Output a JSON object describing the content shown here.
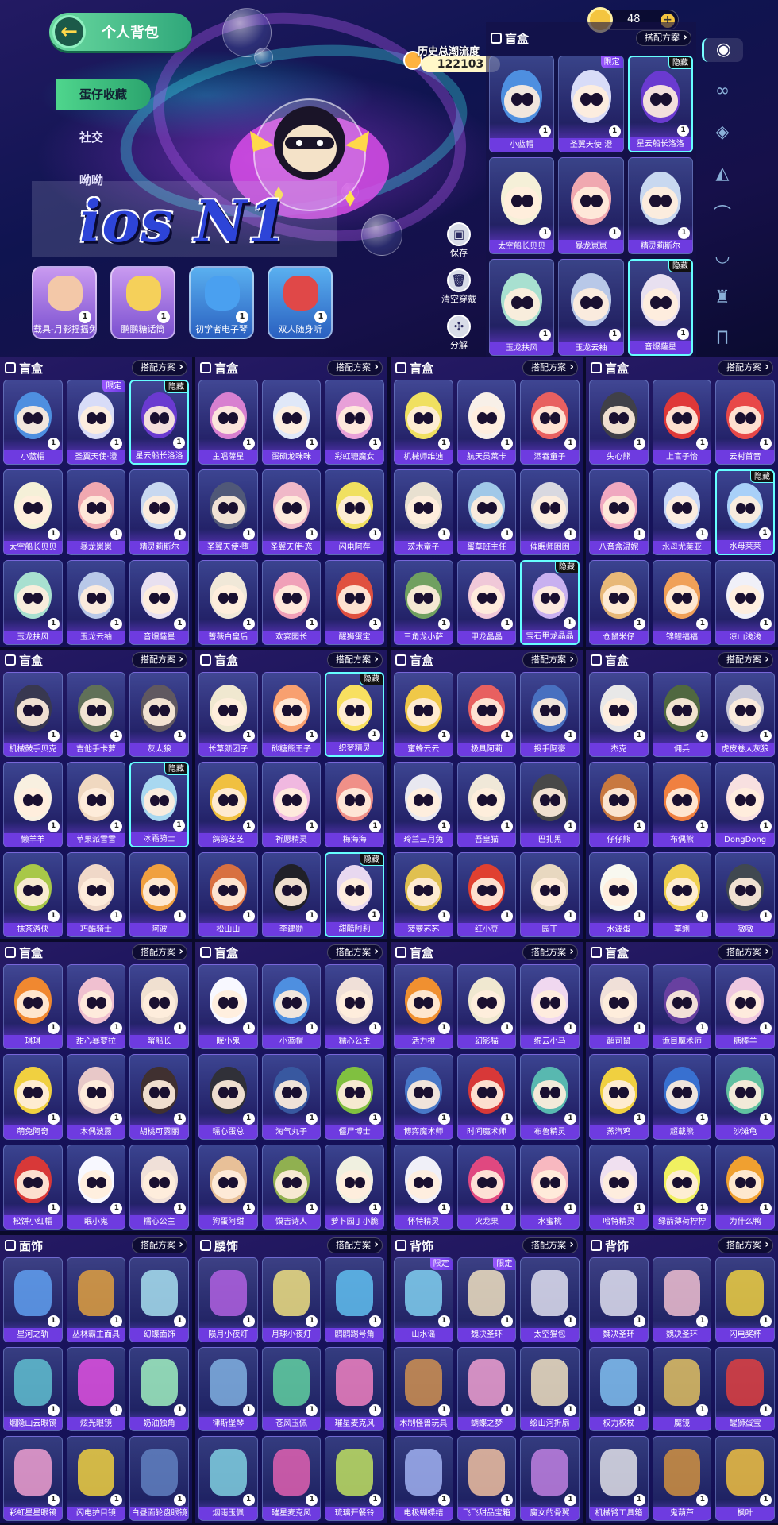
{
  "hero": {
    "back_title": "个人背包",
    "categories": [
      "蛋仔收藏",
      "社交",
      "呦呦"
    ],
    "watermark": "ios N1",
    "quick_items": [
      {
        "label": "载具-月影摇摇兔",
        "count": "1",
        "color": "#f3c8a8"
      },
      {
        "label": "鹏鹏糖话筒",
        "count": "1",
        "color": "#f5d05a"
      },
      {
        "label": "初学者电子琴",
        "count": "1",
        "color": "#4aa0f0"
      },
      {
        "label": "双人随身听",
        "count": "1",
        "color": "#e04848"
      }
    ],
    "side_actions": [
      {
        "label": "保存",
        "icon": "save-icon",
        "glyph": "▣"
      },
      {
        "label": "清空穿戴",
        "icon": "trash-icon",
        "glyph": "🗑"
      },
      {
        "label": "分解",
        "icon": "decompose-icon",
        "glyph": "✣"
      }
    ],
    "heat_label": "历史总潮流度",
    "heat_value": "122103",
    "coins": "48",
    "coin_plus": "+",
    "rail_icons": [
      {
        "name": "egg-figure-icon",
        "glyph": "◉"
      },
      {
        "name": "glasses-icon",
        "glyph": "∞"
      },
      {
        "name": "face-icon",
        "glyph": "◈"
      },
      {
        "name": "bag-icon",
        "glyph": "◭"
      },
      {
        "name": "eyelash-icon",
        "glyph": "⌒"
      },
      {
        "name": "eyes-icon",
        "glyph": "◡"
      },
      {
        "name": "shirt-icon",
        "glyph": "♜"
      },
      {
        "name": "pants-icon",
        "glyph": "Π"
      }
    ]
  },
  "hero_panel": {
    "title": "盲盒",
    "button": "搭配方案",
    "items": [
      {
        "name": "小蓝帽",
        "count": "1",
        "color": "#4e8fe0"
      },
      {
        "name": "圣翼天使·澄",
        "count": "1",
        "color": "#d8dcf8",
        "tag": "限定"
      },
      {
        "name": "星云船长洛洛",
        "count": "1",
        "color": "#6a3ad0",
        "tag": "隐藏"
      },
      {
        "name": "太空船长贝贝",
        "count": "1",
        "color": "#f5f0d8"
      },
      {
        "name": "暴龙崽崽",
        "count": "1",
        "color": "#f0a8b0"
      },
      {
        "name": "精灵莉斯尔",
        "count": "1",
        "color": "#c8d8f0"
      },
      {
        "name": "玉龙扶风",
        "count": "1",
        "color": "#a8e0d0"
      },
      {
        "name": "玉龙云袖",
        "count": "1",
        "color": "#b8c8e8"
      },
      {
        "name": "音爆薩星",
        "count": "1",
        "color": "#e8e0f0",
        "tag": "隐藏"
      }
    ]
  },
  "panels": [
    {
      "title": "盲盒",
      "button": "搭配方案",
      "items": [
        {
          "name": "小蓝帽",
          "count": "1",
          "color": "#4e8fe0"
        },
        {
          "name": "圣翼天使·澄",
          "count": "1",
          "color": "#d8dcf8",
          "tag": "限定"
        },
        {
          "name": "星云船长洛洛",
          "count": "1",
          "color": "#6a3ad0",
          "tag": "隐藏"
        },
        {
          "name": "太空船长贝贝",
          "count": "1",
          "color": "#f5f0d8"
        },
        {
          "name": "暴龙崽崽",
          "count": "1",
          "color": "#f0a8b0"
        },
        {
          "name": "精灵莉斯尔",
          "count": "1",
          "color": "#c8d8f0"
        },
        {
          "name": "玉龙扶风",
          "count": "1",
          "color": "#a8e0d0"
        },
        {
          "name": "玉龙云袖",
          "count": "1",
          "color": "#b8c8e8"
        },
        {
          "name": "音爆薩星",
          "count": "1",
          "color": "#e8e0f0"
        }
      ]
    },
    {
      "title": "盲盒",
      "button": "搭配方案",
      "items": [
        {
          "name": "主唱薩星",
          "count": "1",
          "color": "#d880d0"
        },
        {
          "name": "蛋硕龙咪咪",
          "count": "1",
          "color": "#e0e8f8"
        },
        {
          "name": "彩虹糖魔女",
          "count": "1",
          "color": "#e8a0d8"
        },
        {
          "name": "圣翼天使·堕",
          "count": "1",
          "color": "#505878"
        },
        {
          "name": "圣翼天使·恋",
          "count": "1",
          "color": "#f0b8c8"
        },
        {
          "name": "闪电阿存",
          "count": "1",
          "color": "#f0e060"
        },
        {
          "name": "蔷薇白皇后",
          "count": "1",
          "color": "#f0e8d8"
        },
        {
          "name": "欢宴园长",
          "count": "1",
          "color": "#f0a0b8"
        },
        {
          "name": "醒狮蛋宝",
          "count": "1",
          "color": "#e05040"
        }
      ]
    },
    {
      "title": "盲盒",
      "button": "搭配方案",
      "items": [
        {
          "name": "机械师维迪",
          "count": "1",
          "color": "#f0e060"
        },
        {
          "name": "航天员莱卡",
          "count": "1",
          "color": "#f8f0e8"
        },
        {
          "name": "酒吞童子",
          "count": "1",
          "color": "#e86060"
        },
        {
          "name": "茨木童子",
          "count": "1",
          "color": "#e8e0d0"
        },
        {
          "name": "蛋草班主任",
          "count": "1",
          "color": "#a0c8e8"
        },
        {
          "name": "催眠师困困",
          "count": "1",
          "color": "#d8d8e0"
        },
        {
          "name": "三角龙小萨",
          "count": "1",
          "color": "#70a060"
        },
        {
          "name": "甲龙晶晶",
          "count": "1",
          "color": "#f0c8d8"
        },
        {
          "name": "宝石甲龙晶晶",
          "count": "1",
          "color": "#c8b0f0",
          "tag": "隐藏"
        }
      ]
    },
    {
      "title": "盲盒",
      "button": "搭配方案",
      "items": [
        {
          "name": "失心熊",
          "count": "1",
          "color": "#404048"
        },
        {
          "name": "上官子怡",
          "count": "1",
          "color": "#e03838"
        },
        {
          "name": "云村首音",
          "count": "1",
          "color": "#e84848"
        },
        {
          "name": "八音盒温妮",
          "count": "1",
          "color": "#f0a8c0"
        },
        {
          "name": "水母尤莱亚",
          "count": "1",
          "color": "#c8d8f8"
        },
        {
          "name": "水母莱莱",
          "count": "1",
          "color": "#a8d0f8",
          "tag": "隐藏"
        },
        {
          "name": "仓鼠米仔",
          "count": "1",
          "color": "#e8b878"
        },
        {
          "name": "锦鲤福福",
          "count": "1",
          "color": "#f0a058"
        },
        {
          "name": "凉山浅浅",
          "count": "1",
          "color": "#f0f0f8"
        }
      ]
    },
    {
      "title": "盲盒",
      "button": "搭配方案",
      "items": [
        {
          "name": "机械鼓手贝克",
          "count": "1",
          "color": "#383850"
        },
        {
          "name": "吉他手卡萝",
          "count": "1",
          "color": "#607058"
        },
        {
          "name": "灰太狼",
          "count": "1",
          "color": "#605860"
        },
        {
          "name": "懒羊羊",
          "count": "1",
          "color": "#f8f0e0"
        },
        {
          "name": "苹果派雪雪",
          "count": "1",
          "color": "#f0d8c0"
        },
        {
          "name": "冰霜骑士",
          "count": "1",
          "color": "#a8d8f0",
          "tag": "隐藏"
        },
        {
          "name": "抹茶游侠",
          "count": "1",
          "color": "#a8c848"
        },
        {
          "name": "巧酷骑士",
          "count": "1",
          "color": "#f0d8c8"
        },
        {
          "name": "阿波",
          "count": "1",
          "color": "#f0a040"
        }
      ]
    },
    {
      "title": "盲盒",
      "button": "搭配方案",
      "items": [
        {
          "name": "长草颜团子",
          "count": "1",
          "color": "#f0e8d0"
        },
        {
          "name": "砂糖熊王子",
          "count": "1",
          "color": "#f8a070"
        },
        {
          "name": "织梦精灵",
          "count": "1",
          "color": "#f8e060",
          "tag": "隐藏"
        },
        {
          "name": "鸽鸽芝芝",
          "count": "1",
          "color": "#f0c040"
        },
        {
          "name": "祈愿精灵",
          "count": "1",
          "color": "#f0b8e0"
        },
        {
          "name": "梅海海",
          "count": "1",
          "color": "#f09088"
        },
        {
          "name": "松山山",
          "count": "1",
          "color": "#d87040"
        },
        {
          "name": "李建勋",
          "count": "1",
          "color": "#202028"
        },
        {
          "name": "甜酷阿莉",
          "count": "1",
          "color": "#e8d8f0",
          "tag": "隐藏"
        }
      ]
    },
    {
      "title": "盲盒",
      "button": "搭配方案",
      "items": [
        {
          "name": "蜜蜂云云",
          "count": "1",
          "color": "#f0c848"
        },
        {
          "name": "极具阿莉",
          "count": "1",
          "color": "#e86060"
        },
        {
          "name": "投手阿豪",
          "count": "1",
          "color": "#4870c0"
        },
        {
          "name": "玲兰三月兔",
          "count": "1",
          "color": "#e8e8f0"
        },
        {
          "name": "吾皇猫",
          "count": "1",
          "color": "#f0e8d8"
        },
        {
          "name": "巴扎黑",
          "count": "1",
          "color": "#484848"
        },
        {
          "name": "菠萝苏苏",
          "count": "1",
          "color": "#e0c050"
        },
        {
          "name": "红小豆",
          "count": "1",
          "color": "#e04030"
        },
        {
          "name": "园丁",
          "count": "1",
          "color": "#e8d8c0"
        }
      ]
    },
    {
      "title": "盲盒",
      "button": "搭配方案",
      "items": [
        {
          "name": "杰克",
          "count": "1",
          "color": "#e8e8e8"
        },
        {
          "name": "佣兵",
          "count": "1",
          "color": "#506840"
        },
        {
          "name": "虎皮卷大灰狼",
          "count": "1",
          "color": "#c8c8d8"
        },
        {
          "name": "仔仔熊",
          "count": "1",
          "color": "#c87840"
        },
        {
          "name": "布偶熊",
          "count": "1",
          "color": "#f08040"
        },
        {
          "name": "DongDong",
          "count": "1",
          "color": "#f8e0e0"
        },
        {
          "name": "水波蛋",
          "count": "1",
          "color": "#f8f8f0"
        },
        {
          "name": "草蜊",
          "count": "1",
          "color": "#f0d050"
        },
        {
          "name": "嗷嗷",
          "count": "1",
          "color": "#404850"
        }
      ]
    },
    {
      "title": "盲盒",
      "button": "搭配方案",
      "items": [
        {
          "name": "琪琪",
          "count": "1",
          "color": "#f08830"
        },
        {
          "name": "甜心暴萝拉",
          "count": "1",
          "color": "#f0c0d0"
        },
        {
          "name": "蟹船长",
          "count": "1",
          "color": "#f0e0d0"
        },
        {
          "name": "萌兔阿奇",
          "count": "1",
          "color": "#f0d040"
        },
        {
          "name": "木偶波露",
          "count": "1",
          "color": "#e8c8c8"
        },
        {
          "name": "胡桃可露丽",
          "count": "1",
          "color": "#403030"
        },
        {
          "name": "松饼小红帽",
          "count": "1",
          "color": "#d83838"
        },
        {
          "name": "眠小鬼",
          "count": "1",
          "color": "#f8f8ff"
        },
        {
          "name": "糯心公主",
          "count": "1",
          "color": "#f0e0d8"
        }
      ]
    },
    {
      "title": "盲盒",
      "button": "搭配方案",
      "items": [
        {
          "name": "眠小鬼",
          "count": "1",
          "color": "#f8f8ff"
        },
        {
          "name": "小蓝帽",
          "count": "1",
          "color": "#4e8fe0"
        },
        {
          "name": "糯心公主",
          "count": "1",
          "color": "#f0e0d8"
        },
        {
          "name": "糯心蛋总",
          "count": "1",
          "color": "#303038"
        },
        {
          "name": "淘气丸子",
          "count": "1",
          "color": "#3858a0"
        },
        {
          "name": "僵尸博士",
          "count": "1",
          "color": "#80c040"
        },
        {
          "name": "狗蛋阿甜",
          "count": "1",
          "color": "#e8c098"
        },
        {
          "name": "馍吉诗人",
          "count": "1",
          "color": "#90b050"
        },
        {
          "name": "萝卜园丁小脆",
          "count": "1",
          "color": "#f0f0e0"
        }
      ]
    },
    {
      "title": "盲盒",
      "button": "搭配方案",
      "items": [
        {
          "name": "活力橙",
          "count": "1",
          "color": "#f09030"
        },
        {
          "name": "幻影猫",
          "count": "1",
          "color": "#f0e8d0"
        },
        {
          "name": "绵云小马",
          "count": "1",
          "color": "#f0d8f0"
        },
        {
          "name": "博弈魔术师",
          "count": "1",
          "color": "#4878c8"
        },
        {
          "name": "时间魔术师",
          "count": "1",
          "color": "#d83838"
        },
        {
          "name": "布鲁精灵",
          "count": "1",
          "color": "#58b8b0"
        },
        {
          "name": "怀特精灵",
          "count": "1",
          "color": "#f0f0f8"
        },
        {
          "name": "火龙果",
          "count": "1",
          "color": "#e04880"
        },
        {
          "name": "水蜜桃",
          "count": "1",
          "color": "#f8b8c0"
        }
      ]
    },
    {
      "title": "盲盒",
      "button": "搭配方案",
      "items": [
        {
          "name": "超司鼠",
          "count": "1",
          "color": "#f0e0d8"
        },
        {
          "name": "诡目魔术师",
          "count": "1",
          "color": "#6840a0"
        },
        {
          "name": "糖棒羊",
          "count": "1",
          "color": "#f0c8e0"
        },
        {
          "name": "蒸汽鸡",
          "count": "1",
          "color": "#f0d040"
        },
        {
          "name": "超載熊",
          "count": "1",
          "color": "#3870d0"
        },
        {
          "name": "沙滩龟",
          "count": "1",
          "color": "#60c0a0"
        },
        {
          "name": "哈特精灵",
          "count": "1",
          "color": "#f0e0f0"
        },
        {
          "name": "绿箭薄荷柠柠",
          "count": "1",
          "color": "#f0f060"
        },
        {
          "name": "为什么鸭",
          "count": "1",
          "color": "#f0a030"
        }
      ]
    },
    {
      "title": "面饰",
      "button": "搭配方案",
      "acc": true,
      "items": [
        {
          "name": "星河之轨",
          "count": "1",
          "color": "#60a0f0"
        },
        {
          "name": "丛林霸主面具",
          "count": "1",
          "color": "#e0a040"
        },
        {
          "name": "幻蝶面饰",
          "count": "1",
          "color": "#a8e0f0"
        },
        {
          "name": "烟隐山云眼镜",
          "count": "1",
          "color": "#60c0d0"
        },
        {
          "name": "炫光眼镜",
          "count": "1",
          "color": "#e050e0"
        },
        {
          "name": "奶油独角",
          "count": "1",
          "color": "#a0f0c0"
        },
        {
          "name": "彩虹星星眼镜",
          "count": "1",
          "color": "#f0a0d0"
        },
        {
          "name": "闪电护目镜",
          "count": "1",
          "color": "#f0d040"
        },
        {
          "name": "白昼面轮盘眼镜",
          "count": "1",
          "color": "#6080c0"
        }
      ]
    },
    {
      "title": "腰饰",
      "button": "搭配方案",
      "acc": true,
      "items": [
        {
          "name": "陨月小夜灯",
          "count": "1",
          "color": "#b060e0"
        },
        {
          "name": "月球小夜灯",
          "count": "1",
          "color": "#f0e080"
        },
        {
          "name": "鸥鸥踢号角",
          "count": "1",
          "color": "#60c0f0"
        },
        {
          "name": "律斯堡琴",
          "count": "1",
          "color": "#80b0e0"
        },
        {
          "name": "苍风玉佩",
          "count": "1",
          "color": "#60d0a0"
        },
        {
          "name": "璀星麦克风",
          "count": "1",
          "color": "#f080c0"
        },
        {
          "name": "烟雨玉佩",
          "count": "1",
          "color": "#80d0e0"
        },
        {
          "name": "璀星麦克风",
          "count": "1",
          "color": "#e060b0"
        },
        {
          "name": "琉璃开餐铃",
          "count": "1",
          "color": "#c0e060"
        }
      ]
    },
    {
      "title": "背饰",
      "button": "搭配方案",
      "acc": true,
      "items": [
        {
          "name": "山水谣",
          "count": "1",
          "color": "#80d0f0",
          "tag": "限定"
        },
        {
          "name": "魏决圣环",
          "count": "1",
          "color": "#f0e0c0",
          "tag": "限定"
        },
        {
          "name": "太空猫包",
          "count": "1",
          "color": "#e0e0f0"
        },
        {
          "name": "木制怪兽玩具",
          "count": "1",
          "color": "#d09050"
        },
        {
          "name": "蝴蝶之梦",
          "count": "1",
          "color": "#f0a0d0"
        },
        {
          "name": "绘山河折扇",
          "count": "1",
          "color": "#f0e0c0"
        },
        {
          "name": "电极蝴蝶结",
          "count": "1",
          "color": "#a0b0f0"
        },
        {
          "name": "飞飞甜品宝箱",
          "count": "1",
          "color": "#f0c0a0"
        },
        {
          "name": "魔女的骨翼",
          "count": "1",
          "color": "#c080e0"
        }
      ]
    },
    {
      "title": "背饰",
      "button": "搭配方案",
      "acc": true,
      "items": [
        {
          "name": "魏决圣环",
          "count": "1",
          "color": "#e0e0f0"
        },
        {
          "name": "魏决圣环",
          "count": "1",
          "color": "#f0c0d0"
        },
        {
          "name": "闪电奖杯",
          "count": "1",
          "color": "#f0d040"
        },
        {
          "name": "权力权杖",
          "count": "1",
          "color": "#80c0f0"
        },
        {
          "name": "魔镜",
          "count": "1",
          "color": "#e0c060"
        },
        {
          "name": "醒狮蛋宝",
          "count": "1",
          "color": "#e04040"
        },
        {
          "name": "机械臂工具箱",
          "count": "1",
          "color": "#e0e0e8"
        },
        {
          "name": "鬼葫芦",
          "count": "1",
          "color": "#d09040"
        },
        {
          "name": "枫叶",
          "count": "1",
          "color": "#f0c040"
        }
      ]
    }
  ]
}
